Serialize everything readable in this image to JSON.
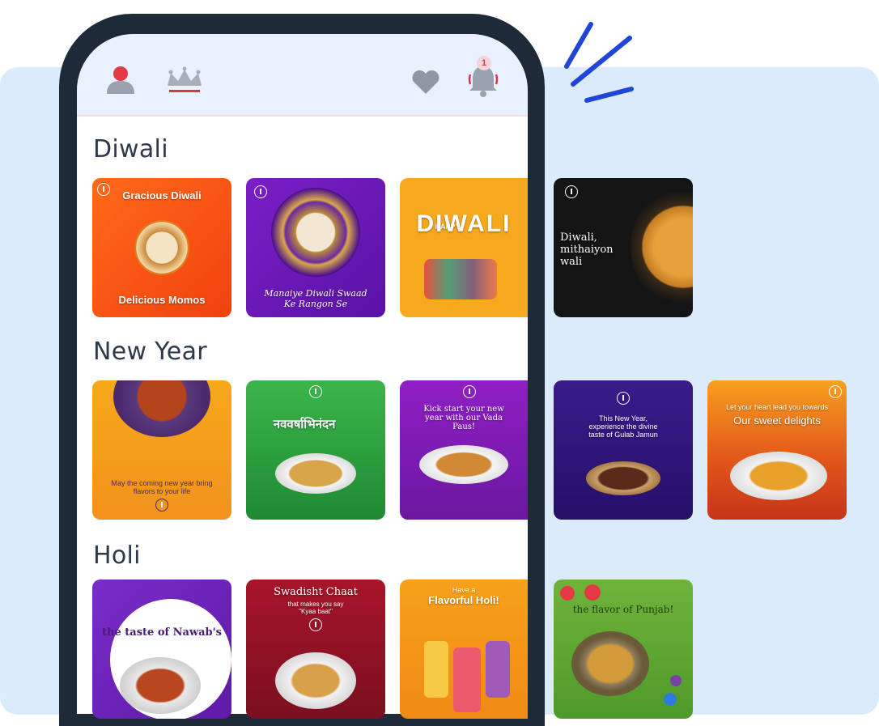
{
  "topbar": {
    "icons": [
      "user-icon",
      "crown-icon",
      "heart-icon",
      "bell-icon"
    ],
    "notification_count": "1"
  },
  "colors": {
    "background": "#dcebfb",
    "phone": "#1e2a38",
    "accent_red": "#d73746",
    "sparkle": "#1f46d6"
  },
  "sections": [
    {
      "title": "Diwali",
      "tiles": [
        {
          "caption_top": "Gracious Diwali",
          "caption_bottom": "Delicious Momos"
        },
        {
          "caption_top": "",
          "caption_bottom": "Manaiye Diwali Swaad Ke Rangon Se"
        },
        {
          "caption_top": "HAPPY",
          "caption_bottom": "DIWALI"
        },
        {
          "caption_top": "Diwali, mithaiyon wali",
          "caption_bottom": ""
        }
      ]
    },
    {
      "title": "New Year",
      "tiles": [
        {
          "caption_top": "",
          "caption_bottom": "May the coming new year bring flavors to your life"
        },
        {
          "caption_top": "नववर्षाभिनंदन",
          "caption_bottom": ""
        },
        {
          "caption_top": "Kick start your new year with our Vada Paus!",
          "caption_bottom": ""
        },
        {
          "caption_top": "This New Year, experience the divine taste of Gulab Jamun",
          "caption_bottom": ""
        },
        {
          "caption_top": "Let your heart lead you towards",
          "caption_bottom": "Our sweet delights"
        }
      ]
    },
    {
      "title": "Holi",
      "tiles": [
        {
          "caption_top": "the taste of Nawab's",
          "caption_bottom": ""
        },
        {
          "caption_top": "Swadisht Chaat",
          "caption_bottom": "that makes you say \"Kyaa baat\""
        },
        {
          "caption_top": "Have a",
          "caption_bottom": "Flavorful Holi!"
        },
        {
          "caption_top": "the flavor of Punjab!",
          "caption_bottom": ""
        }
      ]
    }
  ]
}
